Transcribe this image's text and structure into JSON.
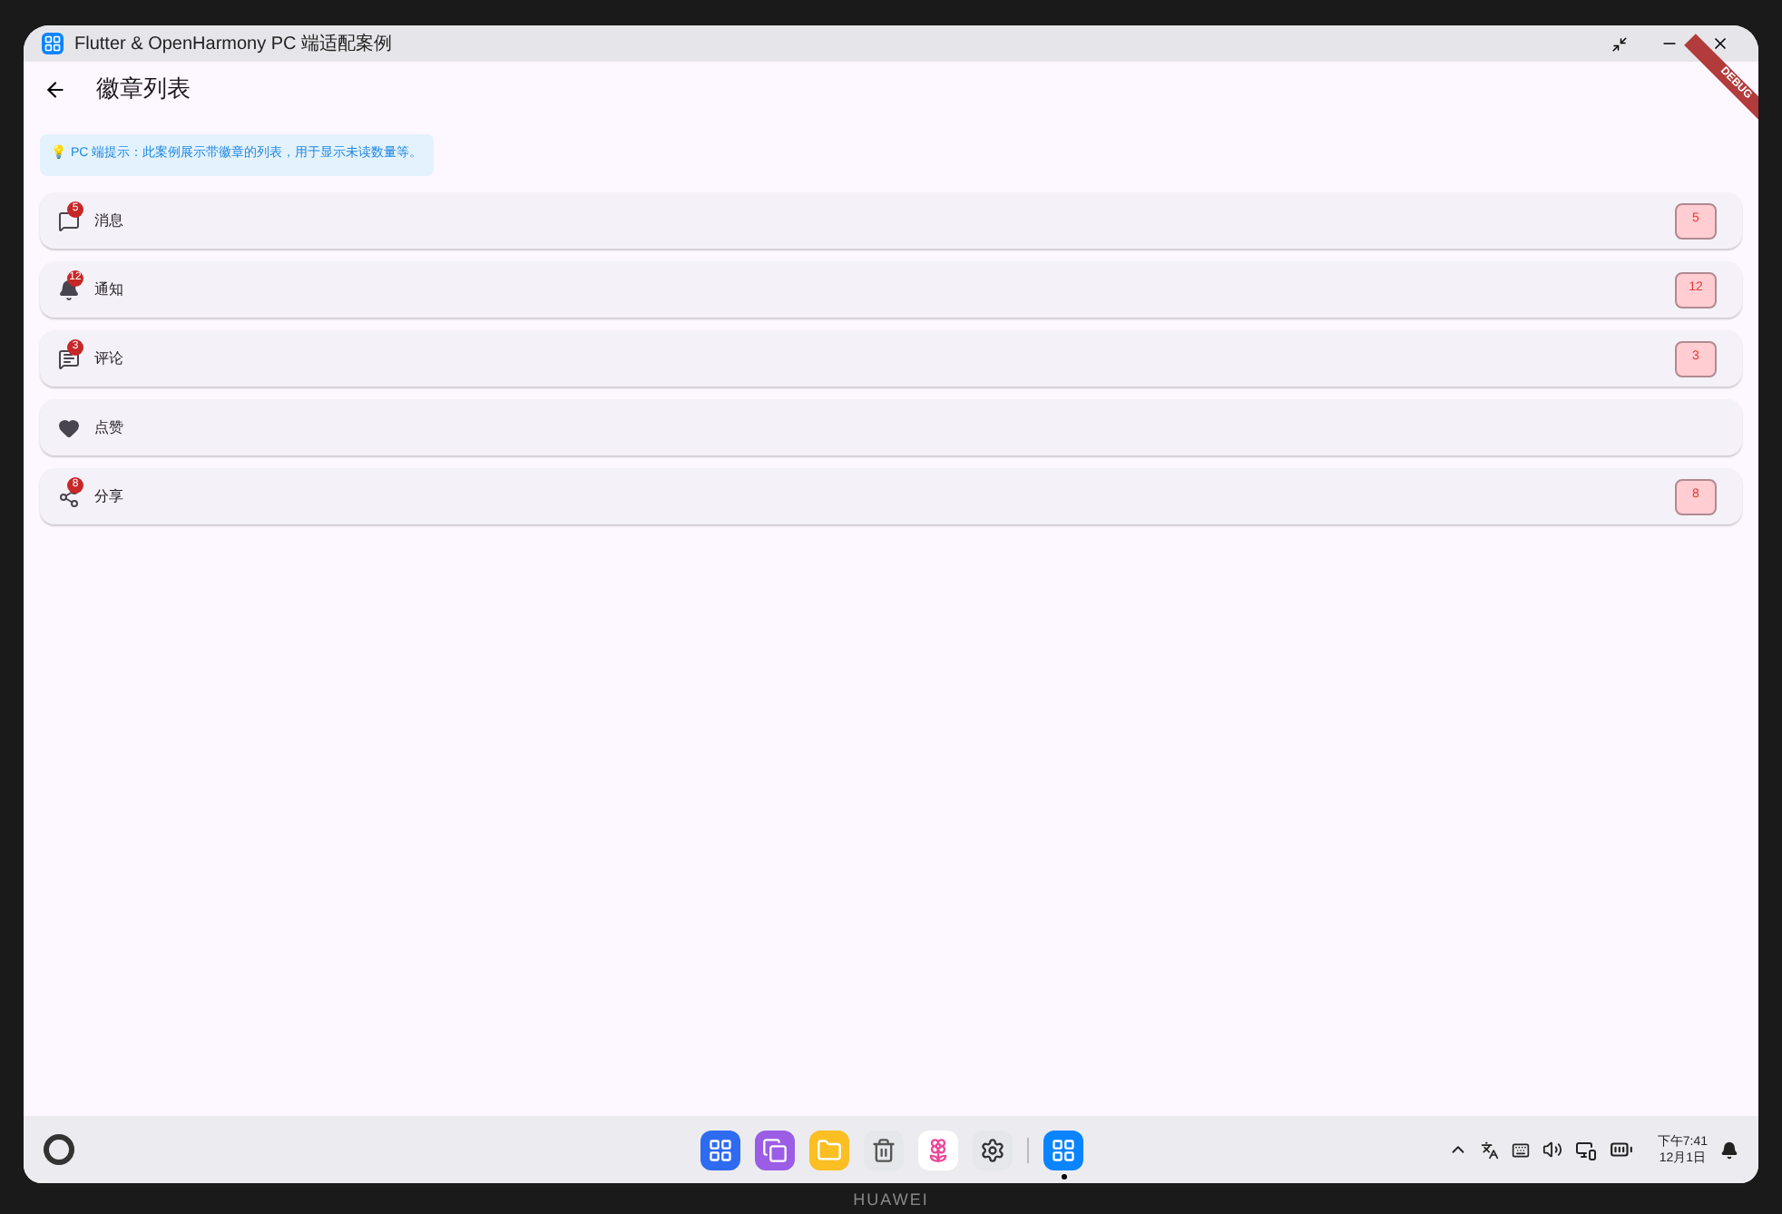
{
  "window": {
    "title": "Flutter & OpenHarmony PC 端适配案例"
  },
  "app_bar": {
    "title": "徽章列表"
  },
  "debug_banner": "DEBUG",
  "hint": "💡 PC 端提示：此案例展示带徽章的列表，用于显示未读数量等。",
  "items": [
    {
      "label": "消息",
      "icon_badge": "5",
      "badge": "5"
    },
    {
      "label": "通知",
      "icon_badge": "12",
      "badge": "12"
    },
    {
      "label": "评论",
      "icon_badge": "3",
      "badge": "3"
    },
    {
      "label": "点赞"
    },
    {
      "label": "分享",
      "icon_badge": "8",
      "badge": "8"
    }
  ],
  "taskbar": {
    "apps": [
      {
        "running": false
      },
      {
        "running": false
      },
      {
        "running": false
      },
      {
        "running": false
      },
      {
        "running": false
      },
      {
        "running": false
      },
      {
        "running": true
      }
    ],
    "time": "下午7:41",
    "date": "12月1日"
  },
  "device_brand": "HUAWEI"
}
